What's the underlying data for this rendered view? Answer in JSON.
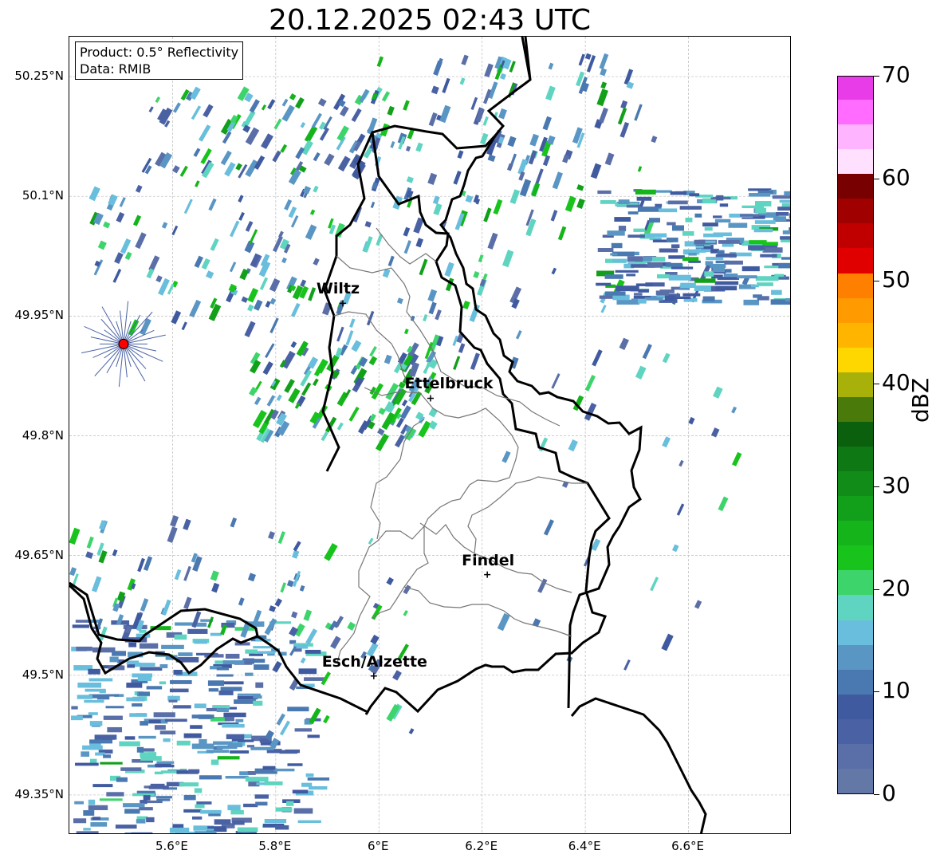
{
  "title": "20.12.2025 02:43 UTC",
  "info": {
    "product": "Product: 0.5° Reflectivity",
    "data": "Data: RMIB"
  },
  "lat_labels": [
    "50.25°N",
    "50.1°N",
    "49.95°N",
    "49.8°N",
    "49.65°N",
    "49.5°N",
    "49.35°N"
  ],
  "lon_labels": [
    "5.6°E",
    "5.8°E",
    "6°E",
    "6.2°E",
    "6.4°E",
    "6.6°E"
  ],
  "cities": [
    {
      "name": "Wiltz",
      "lon": 5.93,
      "lat": 49.966
    },
    {
      "name": "Ettelbruck",
      "lon": 6.1,
      "lat": 49.847
    },
    {
      "name": "Findel",
      "lon": 6.21,
      "lat": 49.626
    },
    {
      "name": "Esch/Alzette",
      "lon": 5.99,
      "lat": 49.499
    }
  ],
  "radar_site": {
    "lon": 5.505,
    "lat": 49.915,
    "color": "#ff0000"
  },
  "map_extent": {
    "lon": [
      5.4,
      6.8
    ],
    "lat": [
      49.3,
      50.3
    ]
  },
  "colorbar": {
    "title": "dBZ",
    "range": [
      0,
      70
    ],
    "tick_labels": [
      "70",
      "60",
      "50",
      "40",
      "30",
      "20",
      "10",
      "0"
    ],
    "colors": [
      "#6478a8",
      "#5a6ea8",
      "#4a62a4",
      "#405aa0",
      "#4a78b0",
      "#5a96c4",
      "#68bedc",
      "#5fd4c0",
      "#3ed46c",
      "#18c41c",
      "#14b41a",
      "#12a01a",
      "#128c18",
      "#0e7814",
      "#0b600e",
      "#4a7a0a",
      "#a8b00a",
      "#ffd700",
      "#ffb400",
      "#ff9a00",
      "#ff8000",
      "#e00000",
      "#c00000",
      "#a00000",
      "#780000",
      "#ffe0ff",
      "#ffb4ff",
      "#ff6cff",
      "#e83ce8"
    ]
  }
}
